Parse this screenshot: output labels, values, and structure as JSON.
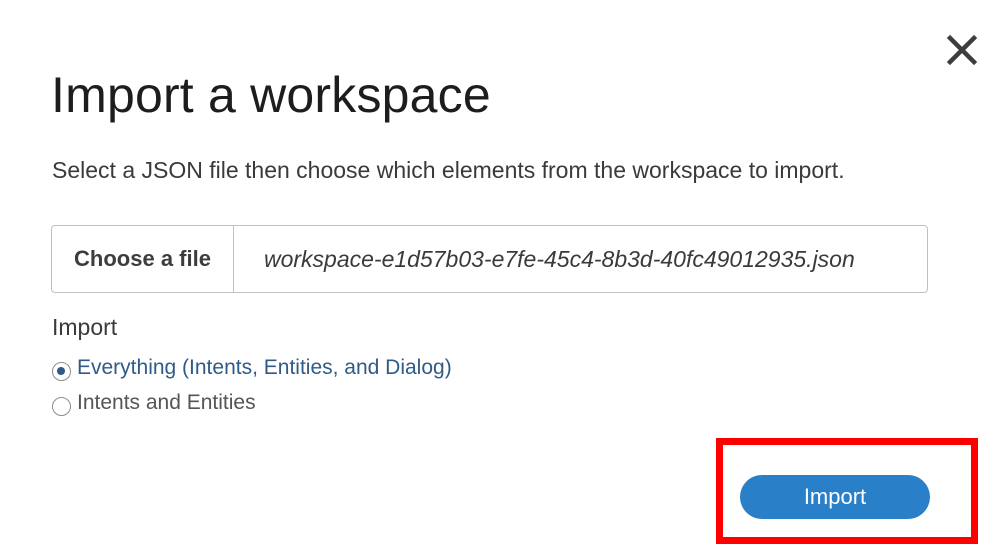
{
  "dialog": {
    "title": "Import a workspace",
    "subtitle": "Select a JSON file then choose which elements from the workspace to import.",
    "close_icon": "close-icon"
  },
  "file_picker": {
    "button_label": "Choose a file",
    "file_name": "workspace-e1d57b03-e7fe-45c4-8b3d-40fc49012935.json"
  },
  "import_options": {
    "label": "Import",
    "options": [
      {
        "label": "Everything (Intents, Entities, and Dialog)",
        "selected": true
      },
      {
        "label": "Intents and Entities",
        "selected": false
      }
    ]
  },
  "actions": {
    "import_label": "Import"
  },
  "colors": {
    "primary_button": "#2a7fc9",
    "selected_option": "#2f5b86",
    "highlight_border": "#ff0000"
  }
}
